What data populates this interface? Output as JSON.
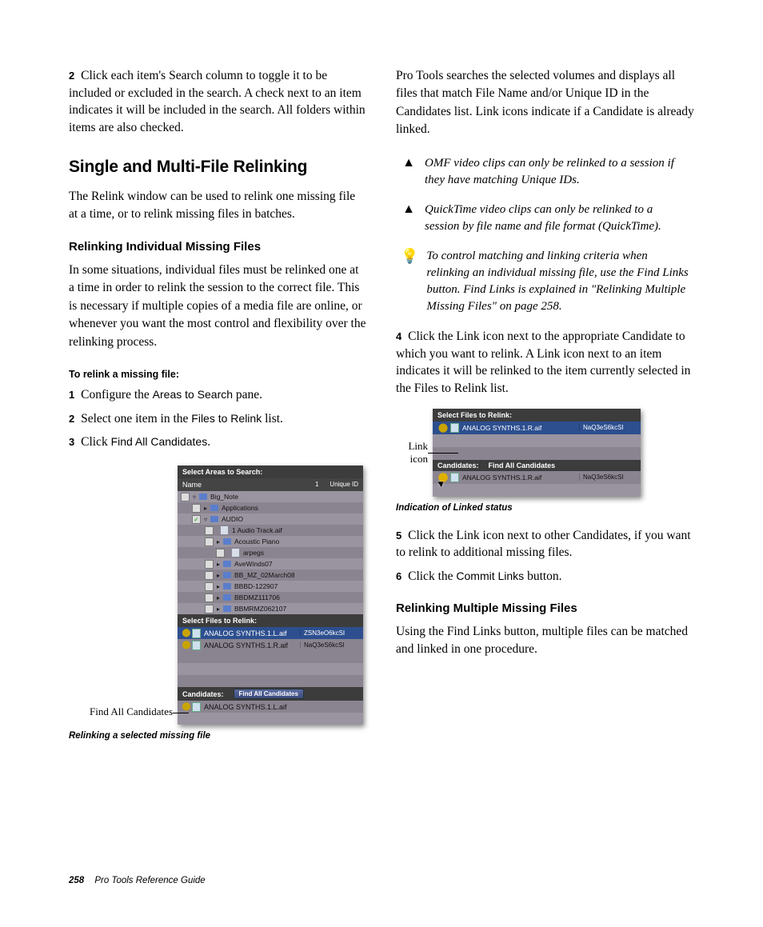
{
  "left": {
    "step2_top": {
      "n": "2",
      "text": "Click each item's Search column to toggle it to be included or excluded in the search. A check next to an item indicates it will be included in the search. All folders within items are also checked."
    },
    "h2": "Single and Multi-File Relinking",
    "p_intro": "The Relink window can be used to relink one missing file at a time, or to relink missing files in batches.",
    "h3a": "Relinking Individual Missing Files",
    "p_indiv": "In some situations, individual files must be relinked one at a time in order to relink the session to the correct file. This is necessary if multiple copies of a media file are online, or whenever you want the most control and flexibility over the relinking process.",
    "steptitle": "To relink a missing file:",
    "s1": {
      "n": "1",
      "text_a": "Configure the ",
      "ui": "Areas to Search",
      "text_b": " pane."
    },
    "s2": {
      "n": "2",
      "text_a": "Select one item in the ",
      "ui": "Files to Relink",
      "text_b": " list."
    },
    "s3": {
      "n": "3",
      "text_a": "Click ",
      "ui": "Find All Candidates",
      "text_b": "."
    },
    "fig1_label": "Find All Candidates",
    "fig1": {
      "hdr_areas": "Select Areas to Search:",
      "cols": {
        "name": "Name",
        "one": "1",
        "uid": "Unique ID"
      },
      "rows": [
        {
          "depth": 0,
          "checked": false,
          "tri": "▿",
          "folder": true,
          "name": "Big_Note"
        },
        {
          "depth": 1,
          "checked": false,
          "tri": "▸",
          "folder": true,
          "name": "Applications"
        },
        {
          "depth": 1,
          "checked": true,
          "tri": "▿",
          "folder": true,
          "name": "AUDIO"
        },
        {
          "depth": 2,
          "checked": false,
          "tri": "",
          "file": true,
          "name": "1 Audio Track.aif"
        },
        {
          "depth": 2,
          "checked": false,
          "tri": "▸",
          "folder": true,
          "name": "Acoustic Piano"
        },
        {
          "depth": 3,
          "checked": false,
          "tri": "",
          "file": true,
          "name": "arpegs"
        },
        {
          "depth": 2,
          "checked": false,
          "tri": "▸",
          "folder": true,
          "name": "AveWinds07"
        },
        {
          "depth": 2,
          "checked": false,
          "tri": "▸",
          "folder": true,
          "name": "BB_MZ_02March08"
        },
        {
          "depth": 2,
          "checked": false,
          "tri": "▸",
          "folder": true,
          "name": "BBBD-122907"
        },
        {
          "depth": 2,
          "checked": false,
          "tri": "▸",
          "folder": true,
          "name": "BBDMZ111706"
        },
        {
          "depth": 2,
          "checked": false,
          "tri": "▸",
          "folder": true,
          "name": "BBMRMZ062107"
        }
      ],
      "hdr_files": "Select Files to Relink:",
      "files": [
        {
          "sel": true,
          "name": "ANALOG SYNTHS.1.L.aif",
          "uid": "ZSN3eO6kcSI"
        },
        {
          "sel": false,
          "name": "ANALOG SYNTHS.1.R.aif",
          "uid": "NaQ3eS6kcSI"
        }
      ],
      "hdr_cand": "Candidates:",
      "btn": "Find All Candidates",
      "cand": {
        "name": "ANALOG SYNTHS.1.L.aif"
      }
    },
    "caption1": "Relinking a selected missing file"
  },
  "right": {
    "p_top": "Pro Tools searches the selected volumes and displays all files that match File Name and/or Unique ID in the Candidates list. Link icons indicate if a Candidate is already linked.",
    "warn1": "OMF video clips can only be relinked to a session if they have matching Unique IDs.",
    "warn2": "QuickTime video clips can only be relinked to a session by file name and file format (QuickTime).",
    "tip": "To control matching and linking criteria when relinking an individual missing file, use the Find Links button. Find Links is explained in \"Relinking Multiple Missing Files\" on page 258.",
    "s4": {
      "n": "4",
      "text": "Click the Link icon next to the appropriate Candidate to which you want to relink. A Link icon next to an item indicates it will be relinked to the item currently selected in the Files to Relink list."
    },
    "fig2_label": "Link icon",
    "fig2": {
      "hdr_files": "Select Files to Relink:",
      "file": {
        "name": "ANALOG SYNTHS.1.R.aif",
        "uid": "NaQ3eS6kcSI"
      },
      "hdr_cand": "Candidates:",
      "btn": "Find All Candidates",
      "cand": {
        "name": "ANALOG SYNTHS.1.R.aif",
        "uid": "NaQ3eS6kcSI"
      }
    },
    "caption2": "Indication of Linked status",
    "s5": {
      "n": "5",
      "text": "Click the Link icon next to other Candidates, if you want to relink to additional missing files."
    },
    "s6": {
      "n": "6",
      "text_a": "Click the ",
      "ui": "Commit Links",
      "text_b": " button."
    },
    "h3b": "Relinking Multiple Missing Files",
    "p_multi": "Using the Find Links button, multiple files can be matched and linked in one procedure."
  },
  "footer": {
    "page": "258",
    "title": "Pro Tools Reference Guide"
  }
}
